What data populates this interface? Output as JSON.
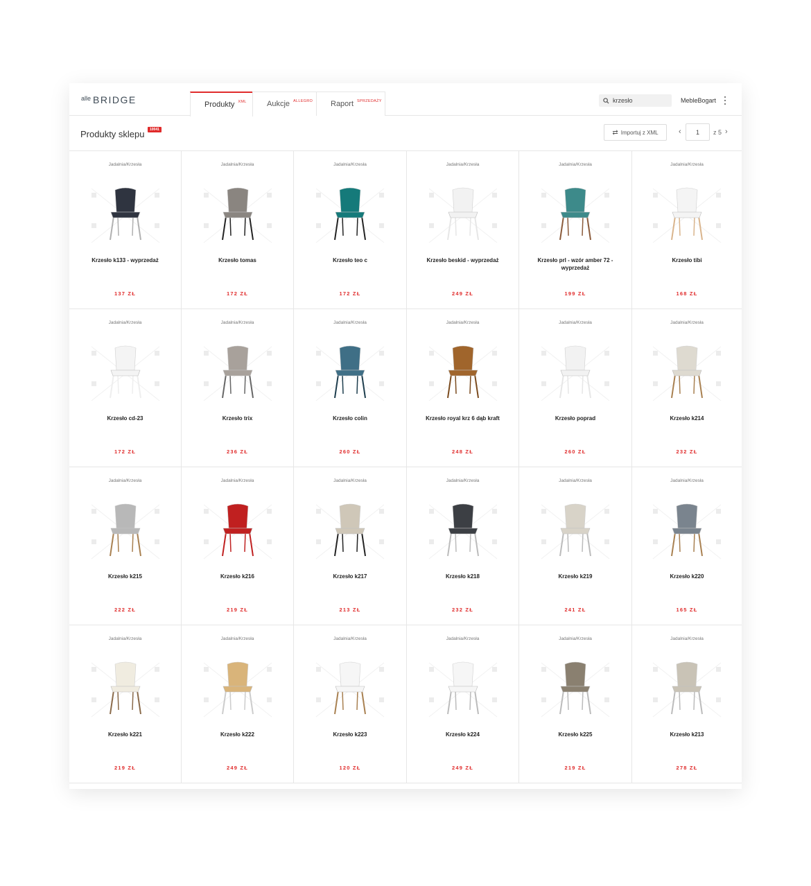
{
  "header": {
    "logo_small": "alle",
    "logo_big": "BRIDGE",
    "tabs": [
      {
        "label": "Produkty",
        "sup": "XML"
      },
      {
        "label": "Aukcje",
        "sup": "ALLEGRO"
      },
      {
        "label": "Raport",
        "sup": "SPRZEDAŻY"
      }
    ],
    "search_value": "krzesło",
    "user_name": "MebleBogart"
  },
  "subheader": {
    "title": "Produkty sklepu",
    "count": "10041",
    "import_label": "Importuj z XML",
    "page": "1",
    "total_pages": "z 5"
  },
  "products": [
    {
      "category": "Jadalnia/Krzesła",
      "name": "Krzesło k133 - wyprzedaż",
      "price": "137 ZŁ",
      "seat": "#2f3440",
      "legs": "#b0b0b0"
    },
    {
      "category": "Jadalnia/Krzesła",
      "name": "Krzesło tomas",
      "price": "172 ZŁ",
      "seat": "#8a8580",
      "legs": "#222222"
    },
    {
      "category": "Jadalnia/Krzesła",
      "name": "Krzesło teo c",
      "price": "172 ZŁ",
      "seat": "#157a7a",
      "legs": "#222222"
    },
    {
      "category": "Jadalnia/Krzesła",
      "name": "Krzesło beskid - wyprzedaż",
      "price": "249 ZŁ",
      "seat": "#f2f2f2",
      "legs": "#e6e6e6"
    },
    {
      "category": "Jadalnia/Krzesła",
      "name": "Krzesło prl - wzór amber 72 - wyprzedaż",
      "price": "199 ZŁ",
      "seat": "#3d8a8a",
      "legs": "#8a5a3a"
    },
    {
      "category": "Jadalnia/Krzesła",
      "name": "Krzesło tibi",
      "price": "168 ZŁ",
      "seat": "#f4f4f4",
      "legs": "#d9b48c"
    },
    {
      "category": "Jadalnia/Krzesła",
      "name": "Krzesło cd-23",
      "price": "172 ZŁ",
      "seat": "#f4f4f4",
      "legs": "#eeeeee"
    },
    {
      "category": "Jadalnia/Krzesła",
      "name": "Krzesło trix",
      "price": "236 ZŁ",
      "seat": "#a8a19b",
      "legs": "#666666"
    },
    {
      "category": "Jadalnia/Krzesła",
      "name": "Krzesło colin",
      "price": "260 ZŁ",
      "seat": "#3f6f86",
      "legs": "#1d3d4d"
    },
    {
      "category": "Jadalnia/Krzesła",
      "name": "Krzesło royal krz 6 dąb kraft",
      "price": "248 ZŁ",
      "seat": "#a0652c",
      "legs": "#7a4a1d"
    },
    {
      "category": "Jadalnia/Krzesła",
      "name": "Krzesło poprad",
      "price": "260 ZŁ",
      "seat": "#f2f2f2",
      "legs": "#e6e6e6"
    },
    {
      "category": "Jadalnia/Krzesła",
      "name": "Krzesło k214",
      "price": "232 ZŁ",
      "seat": "#dedad0",
      "legs": "#a88050"
    },
    {
      "category": "Jadalnia/Krzesła",
      "name": "Krzesło k215",
      "price": "222 ZŁ",
      "seat": "#b8b8b8",
      "legs": "#a88050"
    },
    {
      "category": "Jadalnia/Krzesła",
      "name": "Krzesło k216",
      "price": "219 ZŁ",
      "seat": "#c02020",
      "legs": "#c02020"
    },
    {
      "category": "Jadalnia/Krzesła",
      "name": "Krzesło k217",
      "price": "213 ZŁ",
      "seat": "#cfc7b8",
      "legs": "#222222"
    },
    {
      "category": "Jadalnia/Krzesła",
      "name": "Krzesło k218",
      "price": "232 ZŁ",
      "seat": "#3c3f44",
      "legs": "#bbbbbb"
    },
    {
      "category": "Jadalnia/Krzesła",
      "name": "Krzesło k219",
      "price": "241 ZŁ",
      "seat": "#d8d3c8",
      "legs": "#bbbbbb"
    },
    {
      "category": "Jadalnia/Krzesła",
      "name": "Krzesło k220",
      "price": "165 ZŁ",
      "seat": "#7a848e",
      "legs": "#a88050"
    },
    {
      "category": "Jadalnia/Krzesła",
      "name": "Krzesło k221",
      "price": "219 ZŁ",
      "seat": "#f0ece0",
      "legs": "#8a6a4a"
    },
    {
      "category": "Jadalnia/Krzesła",
      "name": "Krzesło k222",
      "price": "249 ZŁ",
      "seat": "#d9b47a",
      "legs": "#cccccc"
    },
    {
      "category": "Jadalnia/Krzesła",
      "name": "Krzesło k223",
      "price": "120 ZŁ",
      "seat": "#f6f6f6",
      "legs": "#a88050"
    },
    {
      "category": "Jadalnia/Krzesła",
      "name": "Krzesło k224",
      "price": "249 ZŁ",
      "seat": "#f6f6f6",
      "legs": "#bbbbbb"
    },
    {
      "category": "Jadalnia/Krzesła",
      "name": "Krzesło k225",
      "price": "219 ZŁ",
      "seat": "#8a8070",
      "legs": "#bbbbbb"
    },
    {
      "category": "Jadalnia/Krzesła",
      "name": "Krzesło k213",
      "price": "278 ZŁ",
      "seat": "#c9c3b6",
      "legs": "#bbbbbb"
    }
  ]
}
